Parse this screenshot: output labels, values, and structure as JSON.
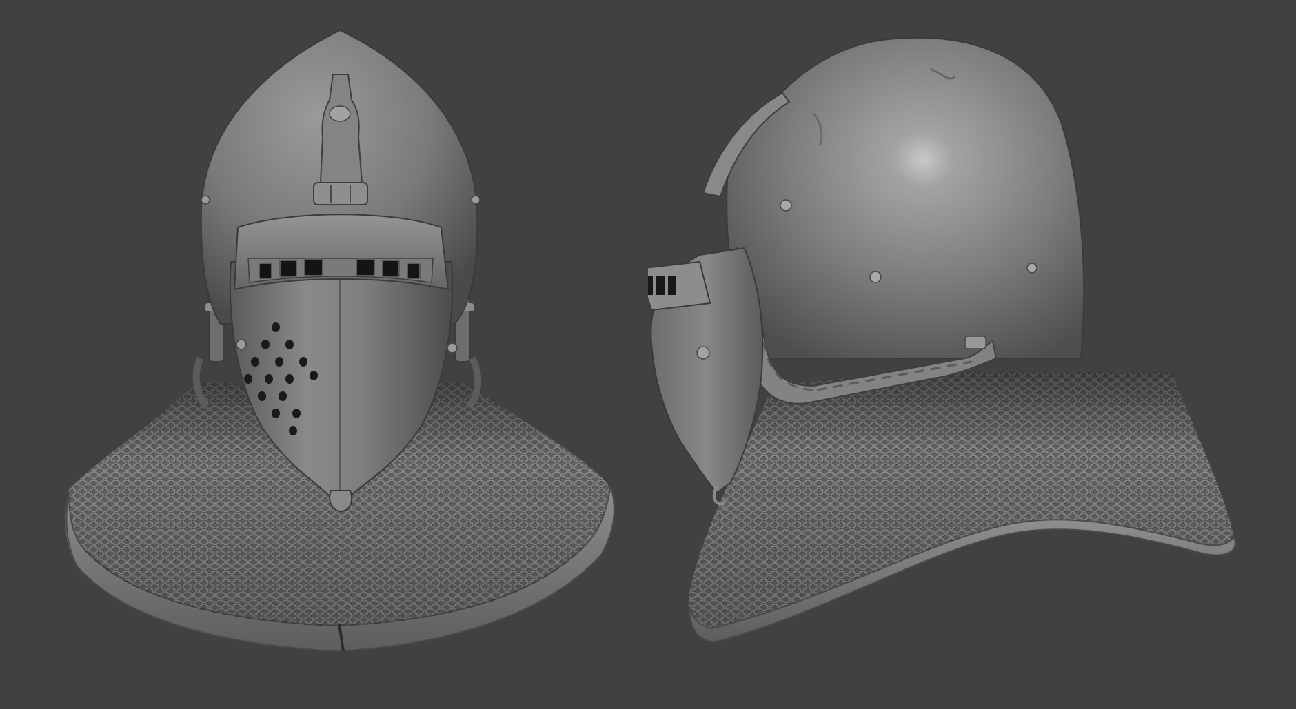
{
  "scene": {
    "background_color": "#414141",
    "metal_base_color": "#7b7b7b",
    "metal_light_color": "#b8b8b8",
    "metal_dark_color": "#3a3a3a",
    "mail_color": "#6f6f6f",
    "hole_color": "#161616"
  },
  "views": [
    {
      "id": "front",
      "subject": "bascinet-helmet-front-icon"
    },
    {
      "id": "side",
      "subject": "bascinet-helmet-side-icon"
    }
  ]
}
